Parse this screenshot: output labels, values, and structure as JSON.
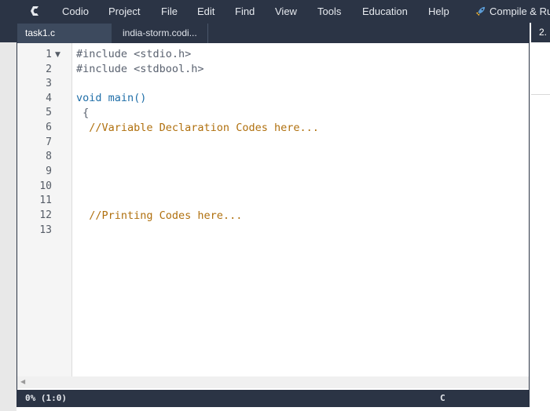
{
  "menubar": {
    "items": [
      "Codio",
      "Project",
      "File",
      "Edit",
      "Find",
      "View",
      "Tools",
      "Education",
      "Help"
    ],
    "compile_label": "Compile & Run"
  },
  "tabs": [
    {
      "label": "task1.c",
      "active": true
    },
    {
      "label": "india-storm.codi...",
      "active": false
    }
  ],
  "right_panel": {
    "tab_label": "2."
  },
  "editor": {
    "lines": [
      "#include <stdio.h>",
      "#include <stdbool.h>",
      "",
      "void main()",
      " {",
      "  //Variable Declaration Codes here...",
      "",
      "",
      "",
      "",
      "",
      "  //Printing Codes here...",
      ""
    ],
    "line_numbers": [
      "1",
      "2",
      "3",
      "4",
      "5",
      "6",
      "7",
      "8",
      "9",
      "10",
      "11",
      "12",
      "13"
    ]
  },
  "statusbar": {
    "position": "0% (1:0)",
    "language": "C"
  },
  "colors": {
    "chrome": "#2b3445",
    "keyword": "#1f6ea8",
    "comment": "#b0700e"
  }
}
